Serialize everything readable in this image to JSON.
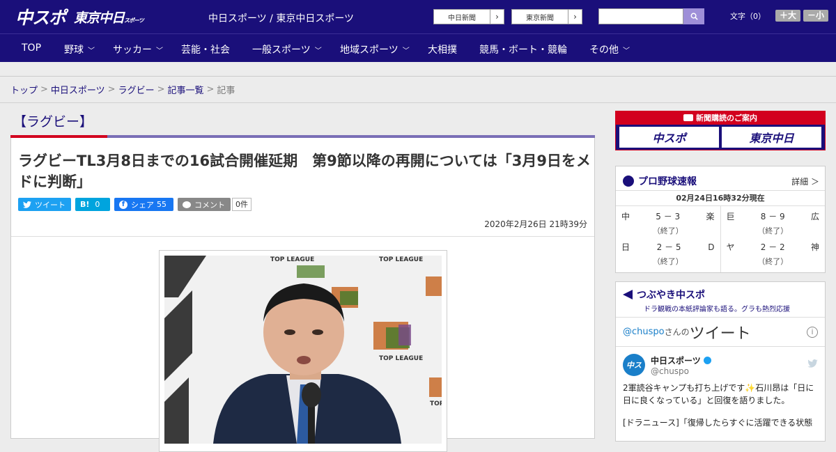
{
  "header": {
    "logo_main": "中スポ",
    "logo_tokyo": "東京中日",
    "logo_tokyo_small": "スポーツ",
    "site_links": "中日スポーツ / 東京中日スポーツ",
    "ext_buttons": [
      "中日新聞",
      "東京新聞"
    ],
    "font_label": "文字（0）",
    "font_up": "＋大",
    "font_down": "－小"
  },
  "nav": {
    "items": [
      {
        "label": "TOP",
        "chevron": false
      },
      {
        "label": "野球",
        "chevron": true
      },
      {
        "label": "サッカー",
        "chevron": true
      },
      {
        "label": "芸能・社会",
        "chevron": false
      },
      {
        "label": "一般スポーツ",
        "chevron": true
      },
      {
        "label": "地域スポーツ",
        "chevron": true
      },
      {
        "label": "大相撲",
        "chevron": false
      },
      {
        "label": "競馬・ボート・競輪",
        "chevron": false
      },
      {
        "label": "その他",
        "chevron": true
      }
    ]
  },
  "breadcrumb": [
    "トップ",
    "中日スポーツ",
    "ラグビー",
    "記事一覧",
    "記事"
  ],
  "article": {
    "category": "【ラグビー】",
    "headline": "ラグビーTL3月8日までの16試合開催延期　第9節以降の再開については「3月9日をメドに判断」",
    "share": {
      "tweet": "ツイート",
      "hatena_icon": "B!",
      "hatena_count": "0",
      "fb": "シェア",
      "fb_count": "55",
      "comment": "コメント",
      "comment_count": "0件"
    },
    "date": "2020年2月26日 21時39分",
    "photo_text": [
      "TOP LEAGUE",
      "TOP LEAGUE",
      "TOP LEAGUE",
      "TOP LE"
    ]
  },
  "sidebar": {
    "promo_title": "新聞購読のご案内",
    "promo_btn1": "中スポ",
    "promo_btn2": "東京中日",
    "baseball": {
      "title": "プロ野球速報",
      "more": "詳細 ＞",
      "timestamp": "02月24日16時32分現在",
      "games": [
        {
          "home": "中",
          "score": "5 － 3",
          "away": "楽",
          "status": "（終了）"
        },
        {
          "home": "巨",
          "score": "8 － 9",
          "away": "広",
          "status": "（終了）"
        },
        {
          "home": "日",
          "score": "2 － 5",
          "away": "D",
          "status": "（終了）"
        },
        {
          "home": "ヤ",
          "score": "2 － 2",
          "away": "神",
          "status": "（終了）"
        }
      ]
    },
    "twitter": {
      "title": "つぶやき中スポ",
      "subtitle": "ドラ観戦の本紙評論家も語る。グラも熱烈応援",
      "handle": "@chuspo",
      "san": "さんの",
      "big": "ツイート",
      "user_name": "中日スポーツ",
      "user_handle": "@chuspo",
      "avatar": "中ス",
      "text1": "2軍読谷キャンプも打ち上げです✨石川昂は「日に日に良くなっている」と回復を語りました。",
      "text2": "[ドラニュース]「復帰したらすぐに活躍できる状態"
    }
  },
  "colors": {
    "brand": "#1a0f7a",
    "accent_red": "#d2001e",
    "twitter": "#1da1f2",
    "facebook": "#1877f2"
  }
}
